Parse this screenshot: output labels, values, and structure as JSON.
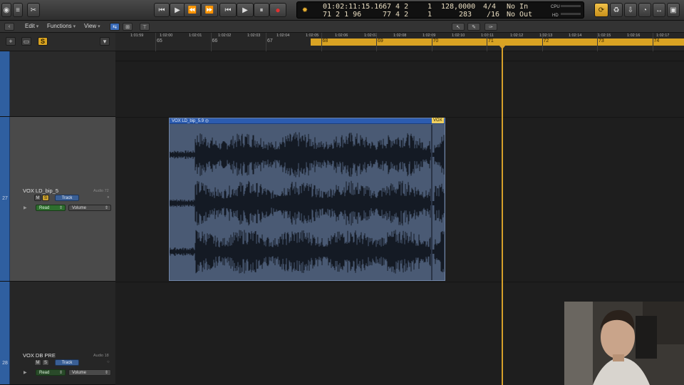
{
  "control_bar": {
    "lcd": {
      "smpte": "01:02:11:15.16",
      "bars_beats": "71  2  1    96",
      "left_locator": "67   4  2",
      "right_locator": "77   4  2",
      "left_div": "1",
      "right_div": "1",
      "tempo": "128,0000",
      "cycle_len": "283",
      "signature": "4/4",
      "division": "/16",
      "midi_in": "No In",
      "midi_out": "No Out",
      "cpu_label": "CPU",
      "hd_label": "HD"
    },
    "transport": {
      "to_start": "⏮",
      "play_from": "▶",
      "rewind": "⏪",
      "forward": "⏩",
      "stop_back": "⏮",
      "play": "▶",
      "pause": "⏸",
      "record": "●"
    }
  },
  "menu": {
    "edit": "Edit",
    "functions": "Functions",
    "view": "View"
  },
  "ruler": {
    "timecodes": [
      "1:01:59",
      "1:02:00",
      "1:02:01",
      "1:02:02",
      "1:02:03",
      "1:02:04",
      "1:02:05",
      "1:02:06",
      "1:02:07",
      "1:02:08",
      "1:02:09",
      "1:02:10",
      "1:02:11",
      "1:02:12",
      "1:02:13",
      "1:02:14",
      "1:02:15",
      "1:02:16",
      "1:02:17"
    ],
    "bars": [
      "65",
      "66",
      "67",
      "68",
      "69",
      "70",
      "71",
      "72",
      "73",
      "74"
    ]
  },
  "header_toolbar": {
    "add": "+",
    "solo": "S"
  },
  "tracks": [
    {
      "number": "27",
      "name": "VOX LD_bip_5",
      "channel": "Audio 72",
      "mute": "M",
      "solo": "S",
      "track_btn": "Track",
      "automation_mode": "Read",
      "automation_param": "Volume"
    },
    {
      "number": "28",
      "name": "VOX DB PRE",
      "channel": "Audio 18",
      "mute": "M",
      "solo": "S",
      "track_btn": "Track",
      "automation_mode": "Read",
      "automation_param": "Volume"
    }
  ],
  "region": {
    "name": "VOX LD_bip_5.9",
    "badge": "◎",
    "name_right": "VOX"
  },
  "colors": {
    "accent_cycle": "#d9a323",
    "region_header": "#2c5cb0",
    "track_stripe": "#2f5fa0",
    "playhead": "#d6a02a"
  },
  "icons": {
    "lcd_mode": "sun-icon",
    "cycle": "cycle-icon",
    "pointer_tool": "pointer-icon",
    "pencil_tool": "pencil-icon"
  }
}
